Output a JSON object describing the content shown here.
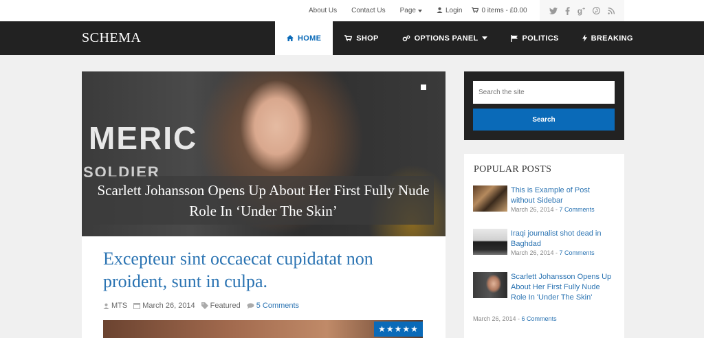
{
  "topbar": {
    "links": [
      "About Us",
      "Contact Us"
    ],
    "page_label": "Page",
    "login_label": "Login",
    "cart_label": "0 items - £0.00"
  },
  "social_icons": [
    "twitter-icon",
    "facebook-icon",
    "google-plus-icon",
    "pinterest-icon",
    "rss-icon"
  ],
  "nav": {
    "logo": "SCHEMA",
    "items": [
      {
        "label": "HOME",
        "icon": "home-icon",
        "active": true
      },
      {
        "label": "SHOP",
        "icon": "cart-icon"
      },
      {
        "label": "OPTIONS PANEL",
        "icon": "cogs-icon",
        "dropdown": true
      },
      {
        "label": "POLITICS",
        "icon": "flag-icon"
      },
      {
        "label": "BREAKING",
        "icon": "bolt-icon"
      }
    ]
  },
  "hero": {
    "caption": "Scarlett Johansson Opens Up About Her First Fully Nude Role In ‘Under The Skin’",
    "bg_text_1": "MERIC",
    "bg_text_2": "SOLDIER"
  },
  "article": {
    "title": "Excepteur sint occaecat cupidatat non proident, sunt in culpa.",
    "author": "MTS",
    "date": "March 26, 2014",
    "category": "Featured",
    "comments": "5 Comments",
    "rating": "★★★★★"
  },
  "search": {
    "placeholder": "Search the site",
    "button_label": "Search"
  },
  "popular": {
    "heading": "POPULAR POSTS",
    "posts": [
      {
        "title": "This is Example of Post without Sidebar",
        "date": "March 26, 2014",
        "comments": "7 Comments"
      },
      {
        "title": "Iraqi journalist shot dead in Baghdad",
        "date": "March 26, 2014",
        "comments": "7 Comments"
      },
      {
        "title": "Scarlett Johansson Opens Up About Her First Fully Nude Role In 'Under The Skin'",
        "date": "March 26, 2014",
        "comments": "6 Comments"
      }
    ]
  },
  "colors": {
    "accent": "#0a6ab8",
    "link": "#2a73b2",
    "navbar": "#222222"
  }
}
